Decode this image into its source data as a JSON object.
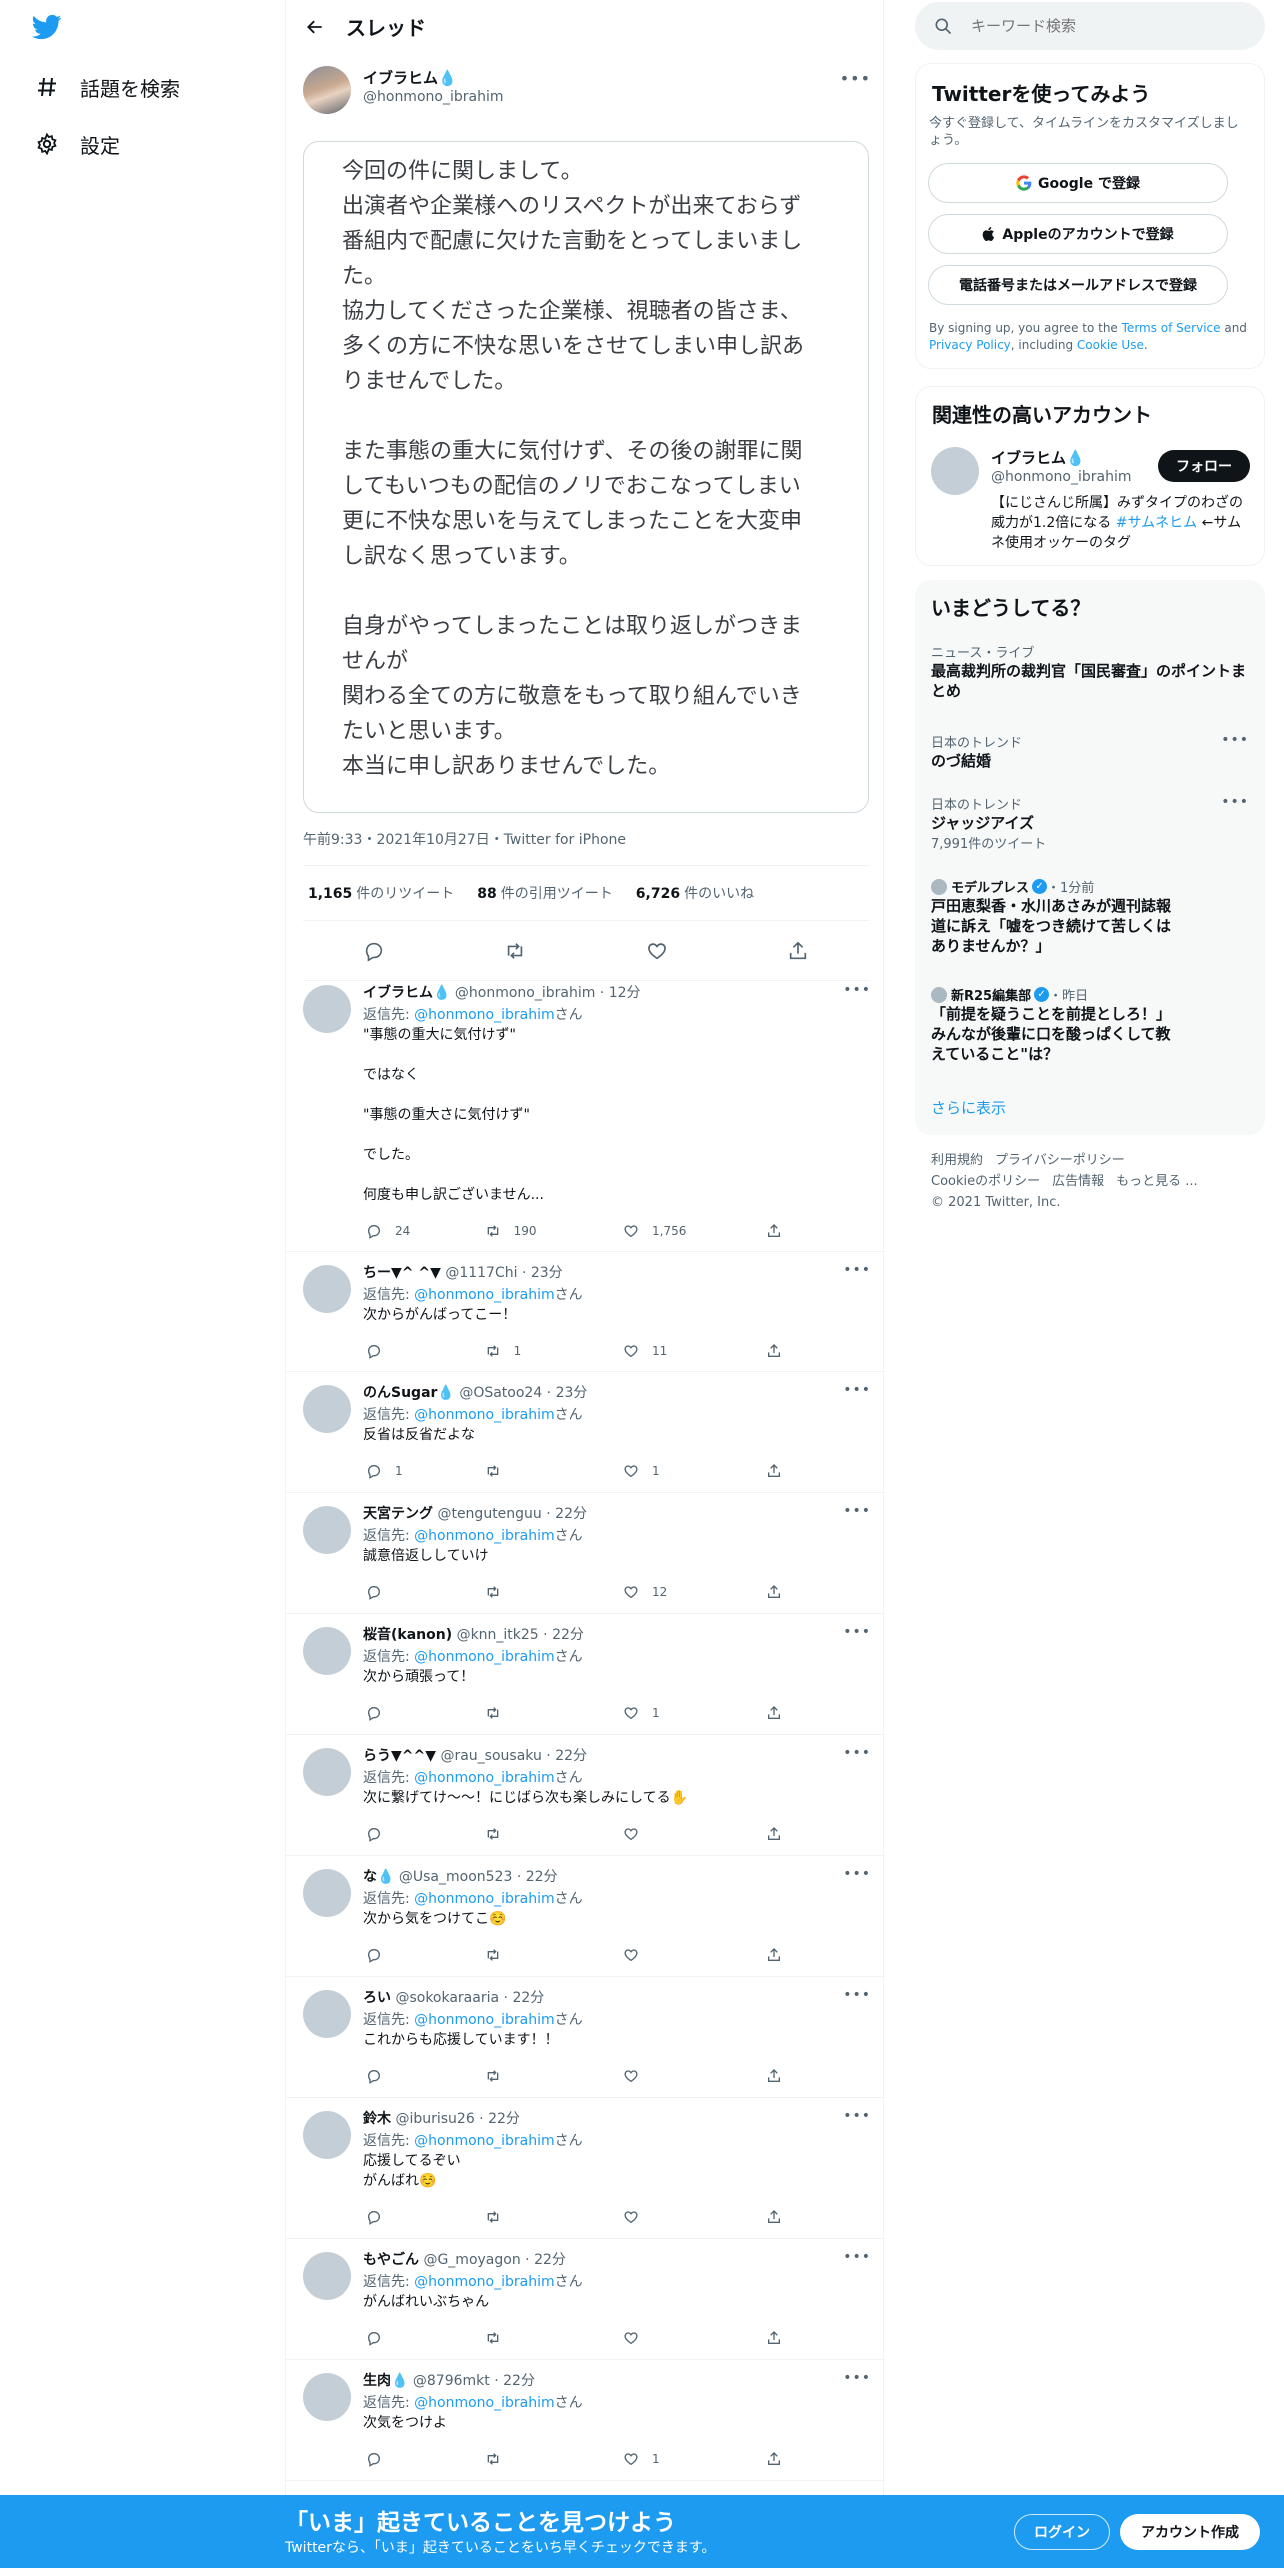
{
  "nav": {
    "explore_label": "話題を検索",
    "settings_label": "設定"
  },
  "header": {
    "title": "スレッド"
  },
  "main_tweet": {
    "name": "イブラヒム💧",
    "handle": "@honmono_ibrahim",
    "lines": [
      "今回の件に関しまして。",
      "出演者や企業様へのリスペクトが出来ておらず",
      "番組内で配慮に欠けた言動をとってしまいまし",
      "た。",
      "協力してくださった企業様、視聴者の皆さま、",
      "多くの方に不快な思いをさせてしまい申し訳あ",
      "りませんでした。",
      "",
      "また事態の重大に気付けず、その後の謝罪に関",
      "してもいつもの配信のノリでおこなってしまい",
      "更に不快な思いを与えてしまったことを大変申",
      "し訳なく思っています。",
      "",
      "自身がやってしまったことは取り返しがつきま",
      "せんが",
      "関わる全ての方に敬意をもって取り組んでいき",
      "たいと思います。",
      "本当に申し訳ありませんでした。"
    ],
    "meta": "午前9:33・2021年10月27日・Twitter for iPhone",
    "retweets": "1,165",
    "retweets_label": "件のリツイート",
    "quotes": "88",
    "quotes_label": "件の引用ツイート",
    "likes": "6,726",
    "likes_label": "件のいいね"
  },
  "reply_prefix": "返信先: ",
  "reply_suffix": "さん",
  "replies": [
    {
      "name": "イブラヒム💧",
      "handle": "@honmono_ibrahim",
      "time": "12分",
      "to": "@honmono_ibrahim",
      "lines": [
        "\"事態の重大に気付けず\"",
        "",
        "ではなく",
        "",
        "\"事態の重大さに気付けず\"",
        "",
        "でした。",
        "",
        "何度も申し訳ございません..."
      ],
      "counts": {
        "reply": "24",
        "retweet": "190",
        "like": "1,756"
      }
    },
    {
      "name": "ちー▼^ ^▼",
      "handle": "@1117Chi",
      "time": "23分",
      "to": "@honmono_ibrahim",
      "lines": [
        "次からがんばってこー！"
      ],
      "counts": {
        "reply": "",
        "retweet": "1",
        "like": "11"
      }
    },
    {
      "name": "のんSugar💧",
      "handle": "@OSatoo24",
      "time": "23分",
      "to": "@honmono_ibrahim",
      "lines": [
        "反省は反省だよな"
      ],
      "counts": {
        "reply": "1",
        "retweet": "",
        "like": "1"
      }
    },
    {
      "name": "天宮テング",
      "handle": "@tengutenguu",
      "time": "22分",
      "to": "@honmono_ibrahim",
      "lines": [
        "誠意倍返ししていけ"
      ],
      "counts": {
        "reply": "",
        "retweet": "",
        "like": "12"
      }
    },
    {
      "name": "桜音(kanon)",
      "handle": "@knn_itk25",
      "time": "22分",
      "to": "@honmono_ibrahim",
      "lines": [
        "次から頑張って！"
      ],
      "counts": {
        "reply": "",
        "retweet": "",
        "like": "1"
      }
    },
    {
      "name": "らう▼^^▼",
      "handle": "@rau_sousaku",
      "time": "22分",
      "to": "@honmono_ibrahim",
      "lines": [
        "次に繋げてけ〜〜！にじばら次も楽しみにしてる✋"
      ],
      "counts": {
        "reply": "",
        "retweet": "",
        "like": ""
      }
    },
    {
      "name": "な💧",
      "handle": "@Usa_moon523",
      "time": "22分",
      "to": "@honmono_ibrahim",
      "lines": [
        "次から気をつけてこ☺️"
      ],
      "counts": {
        "reply": "",
        "retweet": "",
        "like": ""
      }
    },
    {
      "name": "ろい",
      "handle": "@sokokaraaria",
      "time": "22分",
      "to": "@honmono_ibrahim",
      "lines": [
        "これからも応援しています！！"
      ],
      "counts": {
        "reply": "",
        "retweet": "",
        "like": ""
      }
    },
    {
      "name": "鈴木",
      "handle": "@iburisu26",
      "time": "22分",
      "to": "@honmono_ibrahim",
      "lines": [
        "応援してるぞい",
        "がんばれ☺️"
      ],
      "counts": {
        "reply": "",
        "retweet": "",
        "like": ""
      }
    },
    {
      "name": "もやごん",
      "handle": "@G_moyagon",
      "time": "22分",
      "to": "@honmono_ibrahim",
      "lines": [
        "がんばれいぶちゃん"
      ],
      "counts": {
        "reply": "",
        "retweet": "",
        "like": ""
      }
    },
    {
      "name": "生肉💧",
      "handle": "@8796mkt",
      "time": "22分",
      "to": "@honmono_ibrahim",
      "lines": [
        "次気をつけよ"
      ],
      "counts": {
        "reply": "",
        "retweet": "",
        "like": "1"
      }
    }
  ],
  "search": {
    "placeholder": "キーワード検索"
  },
  "signup": {
    "title": "Twitterを使ってみよう",
    "subtitle": "今すぐ登録して、タイムラインをカスタマイズしましょう。",
    "google_label": "Google で登録",
    "apple_label": "Appleのアカウントで登録",
    "phone_label": "電話番号またはメールアドレスで登録",
    "legal_pre": "By signing up, you agree to the ",
    "terms": "Terms of Service",
    "legal_and": " and ",
    "privacy": "Privacy Policy",
    "legal_including": ", including ",
    "cookie": "Cookie Use",
    "legal_end": "."
  },
  "related": {
    "title": "関連性の高いアカウント",
    "name": "イブラヒム💧",
    "handle": "@honmono_ibrahim",
    "follow_label": "フォロー",
    "bio_pre": "【にじさんじ所属】みずタイプのわざの威力が1.2倍になる ",
    "bio_tag": "#サムネヒム",
    "bio_post": " ←サムネ使用オッケーのタグ"
  },
  "trends": {
    "title": "いまどうしてる？",
    "items": [
      {
        "context": "ニュース・ライブ",
        "title": "最高裁判所の裁判官「国民審査」のポイントまとめ",
        "count": ""
      },
      {
        "context": "日本のトレンド",
        "title": "のづ結婚",
        "count": ""
      },
      {
        "context": "日本のトレンド",
        "title": "ジャッジアイズ",
        "count": "7,991件のツイート"
      },
      {
        "source": "モデルプレス",
        "time": "・1分前",
        "title": "戸田恵梨香・水川あさみが週刊誌報道に訴え「嘘をつき続けて苦しくはありませんか？」"
      },
      {
        "source": "新R25編集部",
        "time": "・昨日",
        "title": "「前提を疑うことを前提としろ！」みんなが後輩に口を酸っぱくして教えていること\"は？"
      }
    ],
    "show_more": "さらに表示"
  },
  "footer": {
    "links": [
      "利用規約",
      "プライバシーポリシー",
      "Cookieのポリシー",
      "広告情報",
      "もっと見る ..."
    ],
    "copyright": "© 2021 Twitter, Inc."
  },
  "bottom_bar": {
    "title": "「いま」起きていることを見つけよう",
    "subtitle": "Twitterなら、「いま」起きていることをいち早くチェックできます。",
    "login_label": "ログイン",
    "signup_label": "アカウント作成"
  },
  "colors": {
    "accent": "#1d9bf0",
    "text": "#0f1419",
    "secondary": "#536471"
  }
}
